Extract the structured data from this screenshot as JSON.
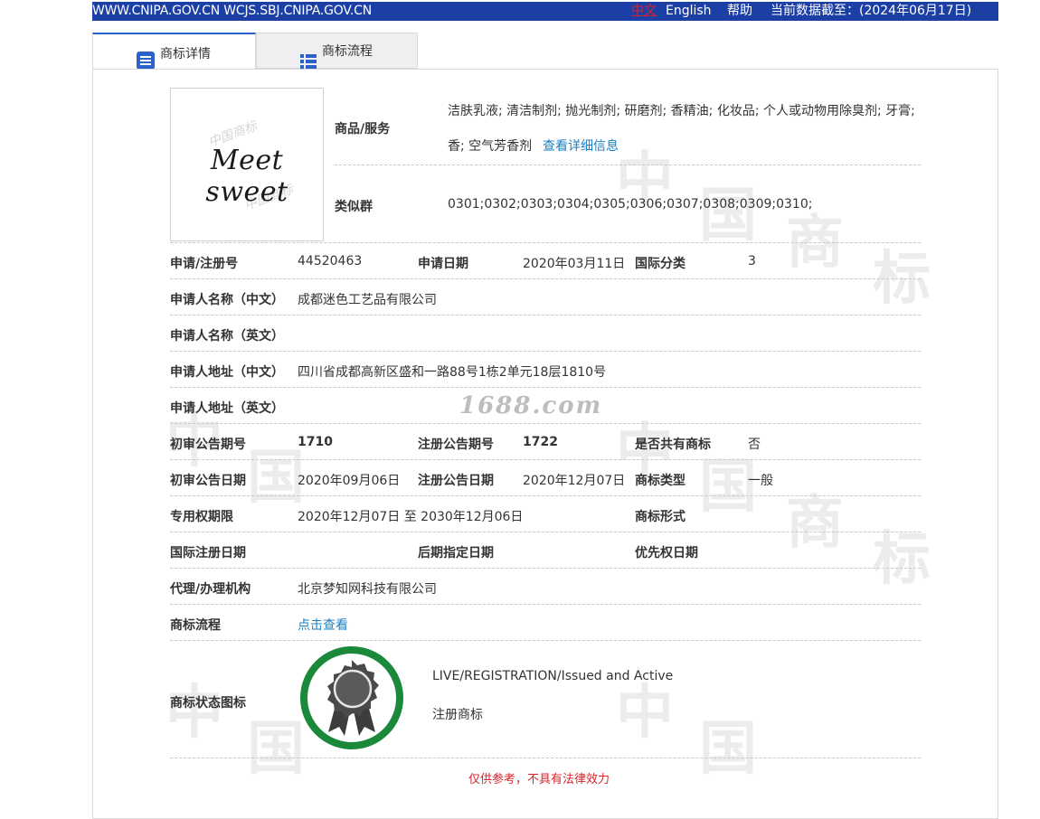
{
  "topbar": {
    "domains": "WWW.CNIPA.GOV.CN WCJS.SBJ.CNIPA.GOV.CN",
    "lang_cn": "中文",
    "lang_en": "English",
    "help": "帮助",
    "data_date": "当前数据截至：(2024年06月17日)"
  },
  "tabs": {
    "detail": "商标详情",
    "flow": "商标流程"
  },
  "logo": {
    "text": "Meet sweet"
  },
  "goods": {
    "label": "商品/服务",
    "line1": "洁肤乳液; 清洁制剂; 抛光制剂; 研磨剂; 香精油; 化妆品; 个人或动物用除臭剂; 牙膏;",
    "line2": "香; 空气芳香剂",
    "more_link": "查看详细信息"
  },
  "similar": {
    "label": "类似群",
    "value": "0301;0302;0303;0304;0305;0306;0307;0308;0309;0310;"
  },
  "rows": {
    "reg_no_label": "申请/注册号",
    "reg_no": "44520463",
    "apply_date_label": "申请日期",
    "apply_date": "2020年03月11日",
    "intl_class_label": "国际分类",
    "intl_class": "3",
    "applicant_cn_label": "申请人名称（中文）",
    "applicant_cn": "成都迷色工艺品有限公司",
    "applicant_en_label": "申请人名称（英文）",
    "applicant_en": "",
    "address_cn_label": "申请人地址（中文）",
    "address_cn": "四川省成都高新区盛和一路88号1栋2单元18层1810号",
    "address_en_label": "申请人地址（英文）",
    "address_en": "",
    "prelim_no_label": "初审公告期号",
    "prelim_no": "1710",
    "reg_pub_no_label": "注册公告期号",
    "reg_pub_no": "1722",
    "shared_label": "是否共有商标",
    "shared": "否",
    "prelim_date_label": "初审公告日期",
    "prelim_date": "2020年09月06日",
    "reg_pub_date_label": "注册公告日期",
    "reg_pub_date": "2020年12月07日",
    "tm_type_label": "商标类型",
    "tm_type": "一般",
    "exclusive_label": "专用权期限",
    "exclusive": "2020年12月07日 至 2030年12月06日",
    "tm_form_label": "商标形式",
    "tm_form": "",
    "intl_reg_label": "国际注册日期",
    "intl_reg": "",
    "later_label": "后期指定日期",
    "later": "",
    "priority_label": "优先权日期",
    "priority": "",
    "agent_label": "代理/办理机构",
    "agent": "北京梦知网科技有限公司",
    "flow_label": "商标流程",
    "flow_link": "点击查看",
    "status_label": "商标状态图标"
  },
  "status": {
    "en": "LIVE/REGISTRATION/Issued and Active",
    "cn": "注册商标"
  },
  "watermark": "1688.com",
  "disclaimer": "仅供参考，不具有法律效力",
  "colors": {
    "topbar": "#1c3fa6",
    "link": "#1a7fc4",
    "badge_ring": "#1a8a3a",
    "disclaimer": "#d8222a"
  },
  "icons": {
    "detail_tab": "document-list-icon",
    "flow_tab": "list-grid-icon",
    "status": "award-badge-icon"
  }
}
